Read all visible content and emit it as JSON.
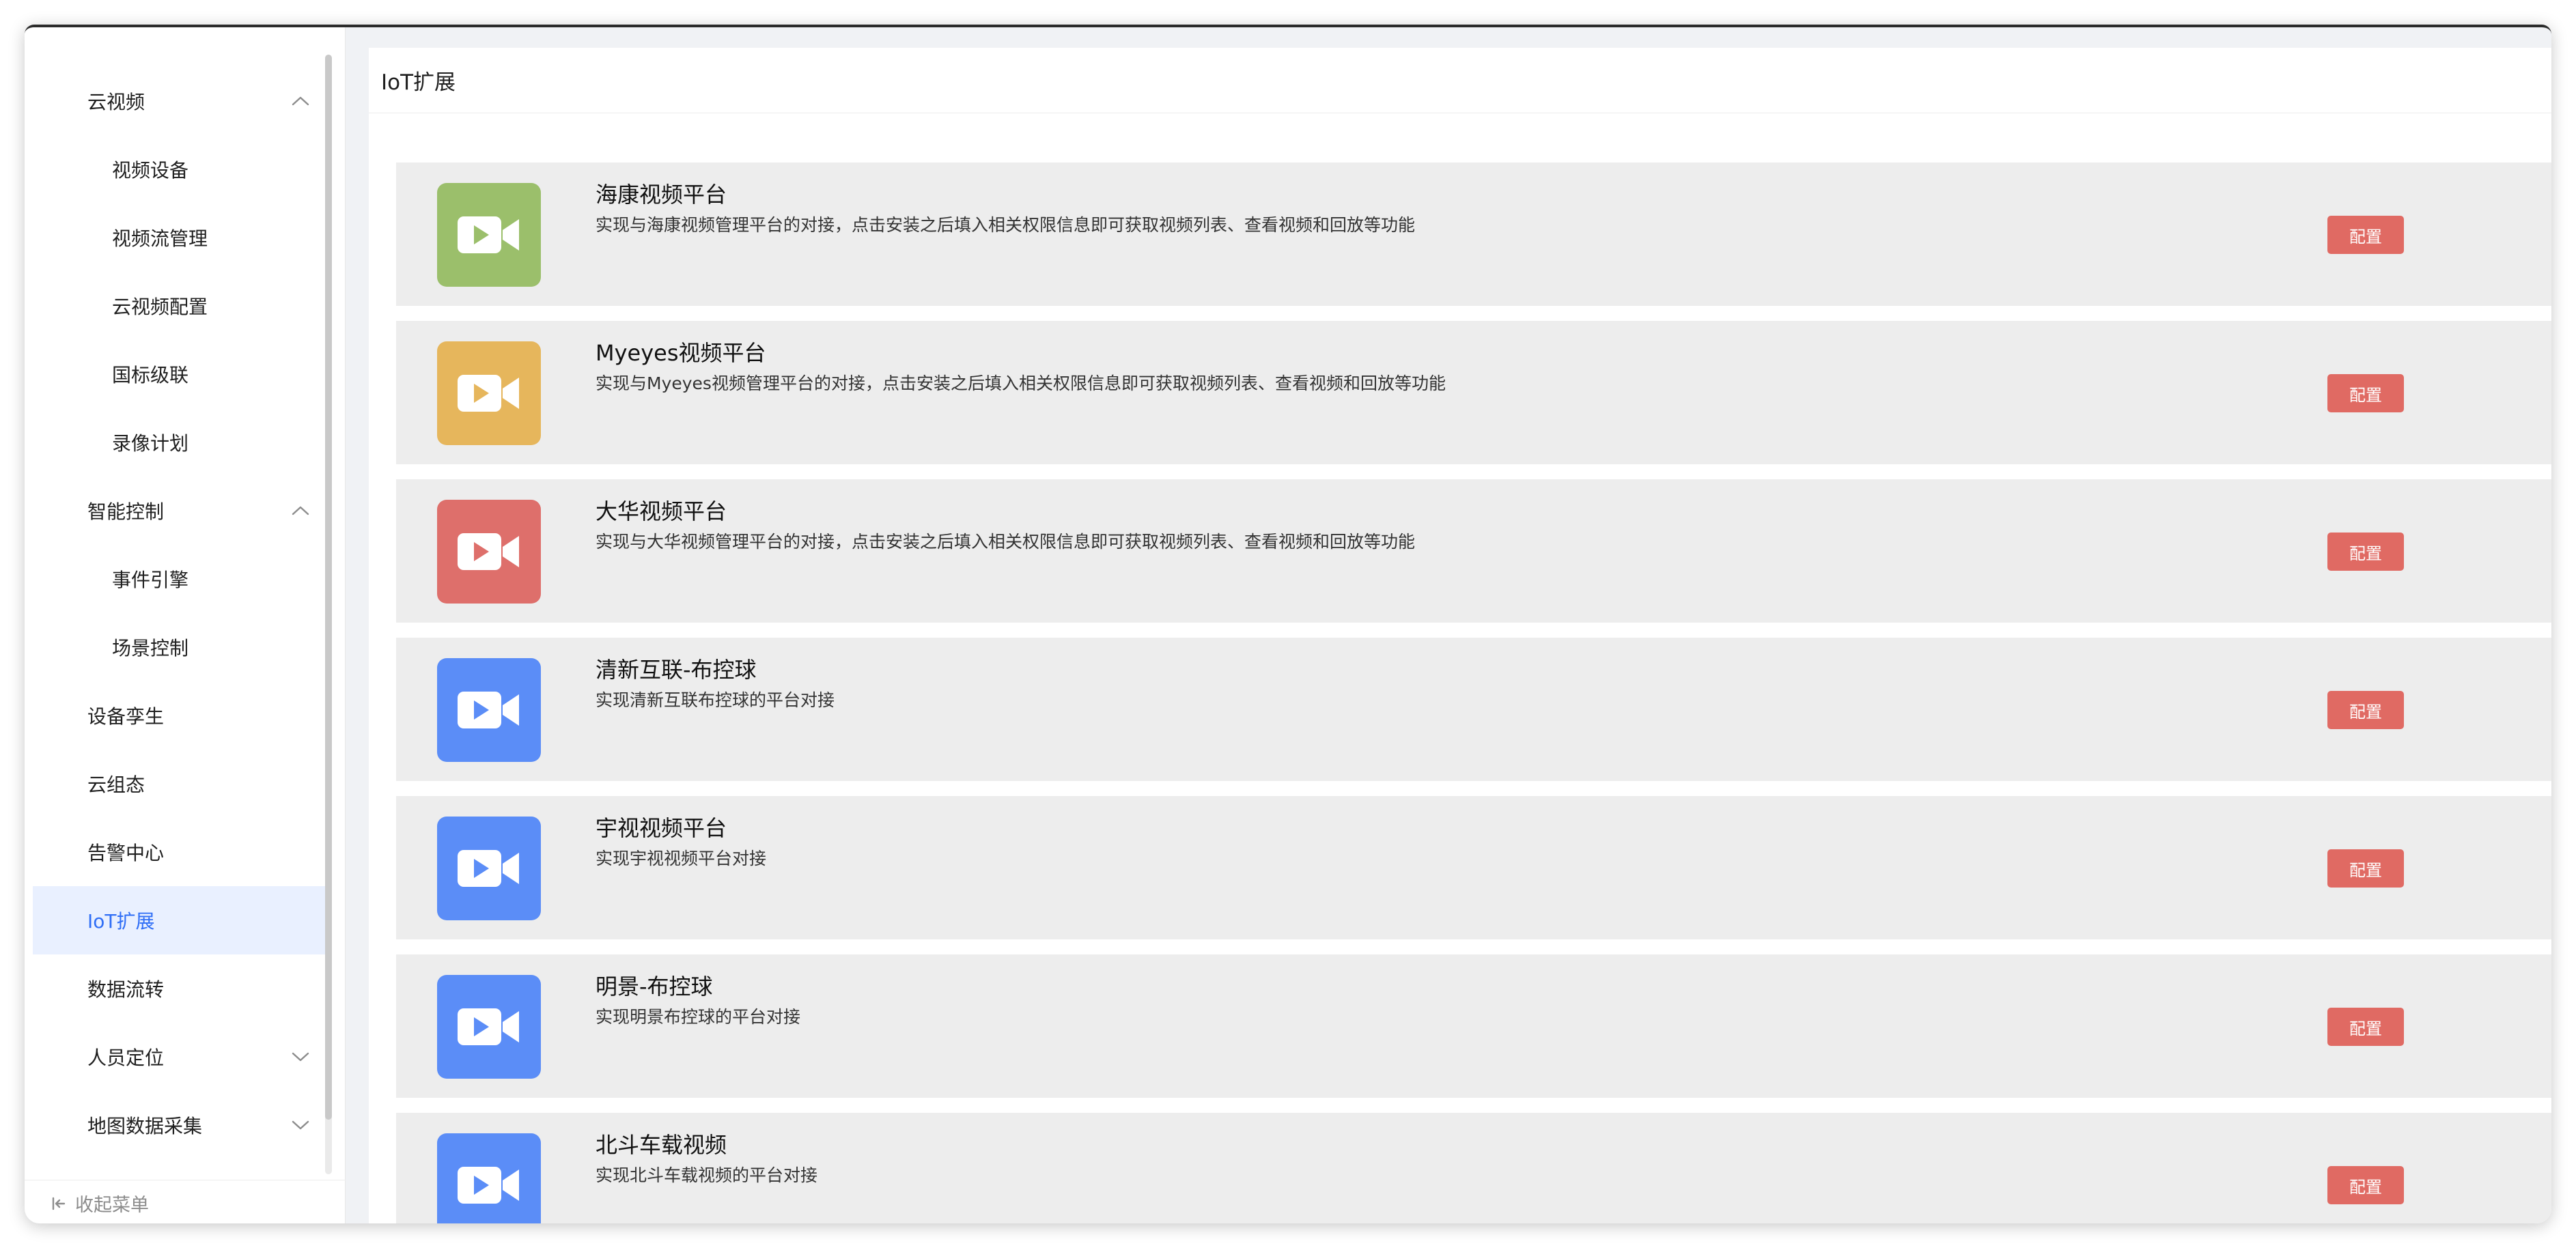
{
  "sidebar": {
    "items": [
      {
        "label": "云视频",
        "level": 1,
        "chevron": "up"
      },
      {
        "label": "视频设备",
        "level": 2
      },
      {
        "label": "视频流管理",
        "level": 2
      },
      {
        "label": "云视频配置",
        "level": 2
      },
      {
        "label": "国标级联",
        "level": 2
      },
      {
        "label": "录像计划",
        "level": 2
      },
      {
        "label": "智能控制",
        "level": 1,
        "chevron": "up"
      },
      {
        "label": "事件引擎",
        "level": 2
      },
      {
        "label": "场景控制",
        "level": 2
      },
      {
        "label": "设备孪生",
        "level": 1
      },
      {
        "label": "云组态",
        "level": 1
      },
      {
        "label": "告警中心",
        "level": 1
      },
      {
        "label": "IoT扩展",
        "level": 1,
        "active": true
      },
      {
        "label": "数据流转",
        "level": 1
      },
      {
        "label": "人员定位",
        "level": 1,
        "chevron": "down"
      },
      {
        "label": "地图数据采集",
        "level": 1,
        "chevron": "down"
      }
    ],
    "collapse_label": "收起菜单",
    "collapse_icon": "collapse-icon"
  },
  "page": {
    "title": "IoT扩展"
  },
  "extensions": [
    {
      "title": "海康视频平台",
      "desc": "实现与海康视频管理平台的对接，点击安装之后填入相关权限信息即可获取视频列表、查看视频和回放等功能",
      "color": "#9bbf6b",
      "button": "配置",
      "icon": "video-camera-icon"
    },
    {
      "title": "Myeyes视频平台",
      "desc": "实现与Myeyes视频管理平台的对接，点击安装之后填入相关权限信息即可获取视频列表、查看视频和回放等功能",
      "color": "#e6b65c",
      "button": "配置",
      "icon": "video-camera-icon"
    },
    {
      "title": "大华视频平台",
      "desc": "实现与大华视频管理平台的对接，点击安装之后填入相关权限信息即可获取视频列表、查看视频和回放等功能",
      "color": "#de6f6b",
      "button": "配置",
      "icon": "video-camera-icon"
    },
    {
      "title": "清新互联-布控球",
      "desc": "实现清新互联布控球的平台对接",
      "color": "#5b8df7",
      "button": "配置",
      "icon": "video-camera-icon"
    },
    {
      "title": "宇视视频平台",
      "desc": "实现宇视视频平台对接",
      "color": "#5b8df7",
      "button": "配置",
      "icon": "video-camera-icon"
    },
    {
      "title": "明景-布控球",
      "desc": "实现明景布控球的平台对接",
      "color": "#5b8df7",
      "button": "配置",
      "icon": "video-camera-icon"
    },
    {
      "title": "北斗车载视频",
      "desc": "实现北斗车载视频的平台对接",
      "color": "#5b8df7",
      "button": "配置",
      "icon": "video-camera-icon"
    }
  ],
  "colors": {
    "active_text": "#2f6ef6",
    "active_bg": "#e9f0ff",
    "config_button": "#e06a63"
  }
}
